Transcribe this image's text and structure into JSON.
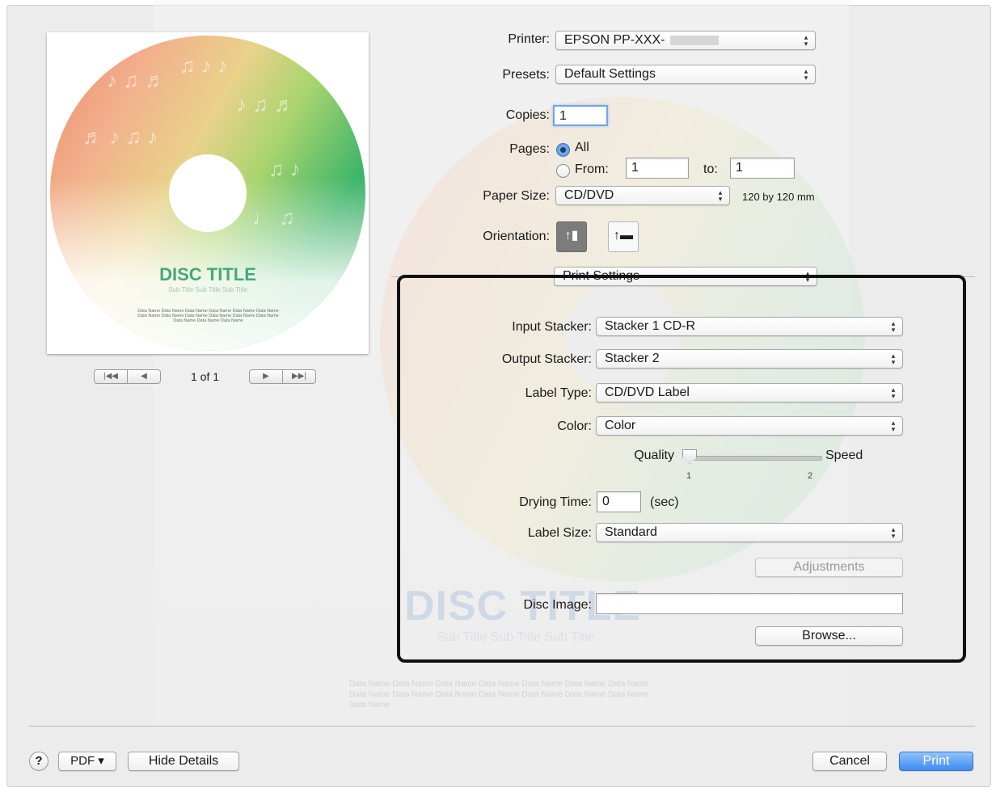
{
  "preview": {
    "disc_title": "DISC TITLE",
    "disc_subtitle": "Sub Title Sub Title Sub Title",
    "disc_data": "Data Name Data Name Data Name Data Name Data Name Data Name Data Name Data Name Data Name Data Name Data Name Data Name Data Name Data Name Data Name",
    "page_of": "1 of 1",
    "first_icon": "|◀◀",
    "prev_icon": "◀",
    "next_icon": "▶",
    "last_icon": "▶▶|"
  },
  "form": {
    "printer_label": "Printer:",
    "printer_value": "EPSON PP-XXX-",
    "presets_label": "Presets:",
    "presets_value": "Default Settings",
    "copies_label": "Copies:",
    "copies_value": "1",
    "pages_label": "Pages:",
    "pages_all": "All",
    "pages_from": "From:",
    "from_value": "1",
    "to_label": "to:",
    "to_value": "1",
    "paper_size_label": "Paper Size:",
    "paper_size_value": "CD/DVD",
    "paper_size_dims": "120 by 120 mm",
    "orientation_label": "Orientation:",
    "section_value": "Print Settings"
  },
  "print_settings": {
    "input_stacker_label": "Input Stacker:",
    "input_stacker_value": "Stacker 1 CD-R",
    "output_stacker_label": "Output Stacker:",
    "output_stacker_value": "Stacker 2",
    "label_type_label": "Label Type:",
    "label_type_value": "CD/DVD Label",
    "color_label": "Color:",
    "color_value": "Color",
    "quality_label": "Quality",
    "speed_label": "Speed",
    "tick_1": "1",
    "tick_2": "2",
    "slider_value": 1,
    "drying_time_label": "Drying Time:",
    "drying_time_value": "0",
    "drying_unit": "(sec)",
    "label_size_label": "Label Size:",
    "label_size_value": "Standard",
    "adjustments_button": "Adjustments",
    "disc_image_label": "Disc Image:",
    "disc_image_value": "",
    "browse_button": "Browse..."
  },
  "footer": {
    "help": "?",
    "pdf_button": "PDF ▾",
    "hide_details_button": "Hide Details",
    "cancel_button": "Cancel",
    "print_button": "Print"
  },
  "background": {
    "ghost_title": "DISC TITLE",
    "ghost_subtitle": "Sub Title Sub Title Sub Title",
    "ghost_lines": "Data Name Data Name Data Name Data Name Data Name Data Name Data Name Data Name Data Name Data Name Data Name Data Name Data Name Data Name Data Name"
  },
  "colors": {
    "accent": "#3e8bf2",
    "highlight_box": "#111111",
    "sheet_bg": "#ececec"
  }
}
